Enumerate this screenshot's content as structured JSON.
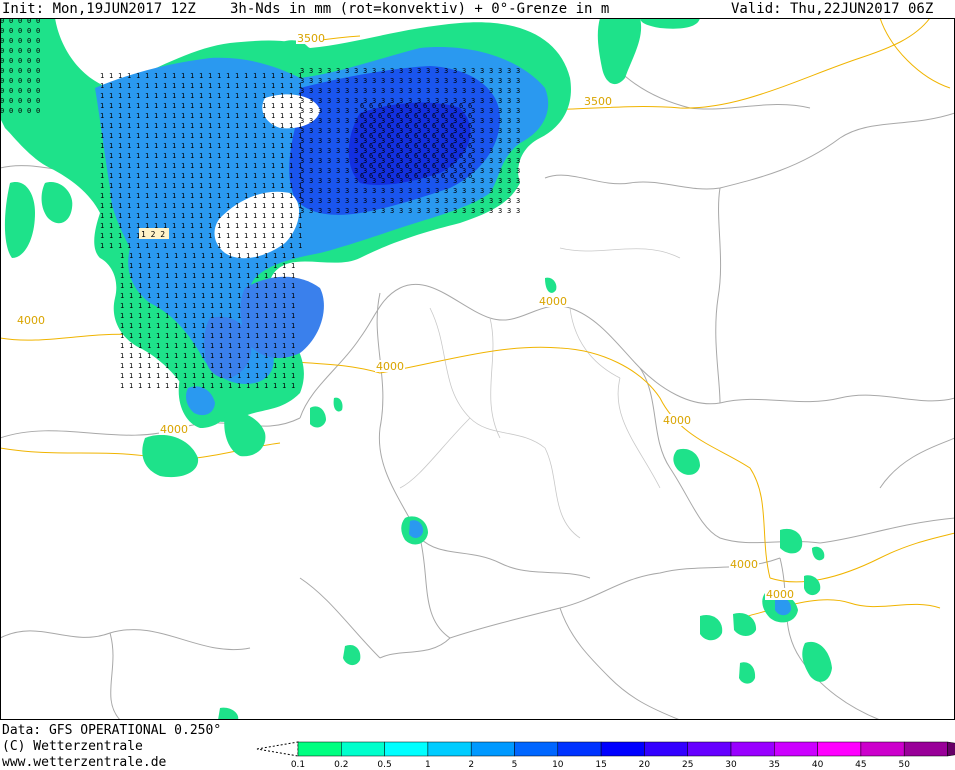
{
  "header": {
    "init": "Init: Mon,19JUN2017 12Z",
    "title": "3h-Nds in mm (rot=konvektiv) + 0°-Grenze in m",
    "valid": "Valid: Thu,22JUN2017 06Z"
  },
  "map": {
    "isolines": [
      "3500",
      "3500",
      "4000",
      "4000",
      "4000",
      "4000",
      "4000",
      "4000",
      "4000"
    ],
    "cell_labels": [
      "1 2 2"
    ]
  },
  "footer": {
    "data_source": "Data: GFS OPERATIONAL 0.250°",
    "copyright": "(C) Wetterzentrale",
    "url": "www.wetterzentrale.de"
  },
  "legend": {
    "ticks": [
      "0.1",
      "0.2",
      "0.5",
      "1",
      "2",
      "5",
      "10",
      "15",
      "20",
      "25",
      "30",
      "35",
      "40",
      "45",
      "50"
    ],
    "colors": [
      "#00ff80",
      "#00ffcc",
      "#00ffff",
      "#00ccff",
      "#0099ff",
      "#0066ff",
      "#0033ff",
      "#0000ff",
      "#3300ff",
      "#6600ff",
      "#9900ff",
      "#cc00ff",
      "#ff00ff",
      "#cc00cc",
      "#990099",
      "#660066"
    ]
  }
}
